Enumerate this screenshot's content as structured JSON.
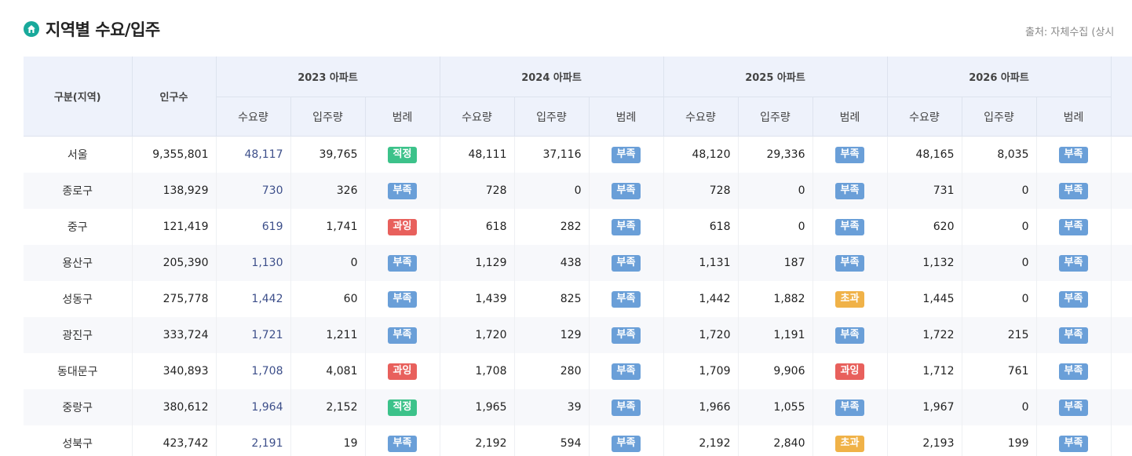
{
  "header": {
    "title": "지역별 수요/입주",
    "source": "출처: 자체수집 (상시"
  },
  "colors": {
    "적정": "#3cc28a",
    "부족": "#6a9fd8",
    "과잉": "#e8605c",
    "초과": "#f0b248"
  },
  "table": {
    "col_region": "구분(지역)",
    "col_population": "인구수",
    "years": [
      "2023 아파트",
      "2024 아파트",
      "2025 아파트",
      "2026 아파트"
    ],
    "sub": {
      "demand": "수요량",
      "supply": "입주량",
      "legend": "범례"
    },
    "rows": [
      {
        "region": "서울",
        "population": "9,355,801",
        "y": [
          [
            "48,117",
            "39,765",
            "적정"
          ],
          [
            "48,111",
            "37,116",
            "부족"
          ],
          [
            "48,120",
            "29,336",
            "부족"
          ],
          [
            "48,165",
            "8,035",
            "부족"
          ]
        ]
      },
      {
        "region": "종로구",
        "population": "138,929",
        "y": [
          [
            "730",
            "326",
            "부족"
          ],
          [
            "728",
            "0",
            "부족"
          ],
          [
            "728",
            "0",
            "부족"
          ],
          [
            "731",
            "0",
            "부족"
          ]
        ]
      },
      {
        "region": "중구",
        "population": "121,419",
        "y": [
          [
            "619",
            "1,741",
            "과잉"
          ],
          [
            "618",
            "282",
            "부족"
          ],
          [
            "618",
            "0",
            "부족"
          ],
          [
            "620",
            "0",
            "부족"
          ]
        ]
      },
      {
        "region": "용산구",
        "population": "205,390",
        "y": [
          [
            "1,130",
            "0",
            "부족"
          ],
          [
            "1,129",
            "438",
            "부족"
          ],
          [
            "1,131",
            "187",
            "부족"
          ],
          [
            "1,132",
            "0",
            "부족"
          ]
        ]
      },
      {
        "region": "성동구",
        "population": "275,778",
        "y": [
          [
            "1,442",
            "60",
            "부족"
          ],
          [
            "1,439",
            "825",
            "부족"
          ],
          [
            "1,442",
            "1,882",
            "초과"
          ],
          [
            "1,445",
            "0",
            "부족"
          ]
        ]
      },
      {
        "region": "광진구",
        "population": "333,724",
        "y": [
          [
            "1,721",
            "1,211",
            "부족"
          ],
          [
            "1,720",
            "129",
            "부족"
          ],
          [
            "1,720",
            "1,191",
            "부족"
          ],
          [
            "1,722",
            "215",
            "부족"
          ]
        ]
      },
      {
        "region": "동대문구",
        "population": "340,893",
        "y": [
          [
            "1,708",
            "4,081",
            "과잉"
          ],
          [
            "1,708",
            "280",
            "부족"
          ],
          [
            "1,709",
            "9,906",
            "과잉"
          ],
          [
            "1,712",
            "761",
            "부족"
          ]
        ]
      },
      {
        "region": "중랑구",
        "population": "380,612",
        "y": [
          [
            "1,964",
            "2,152",
            "적정"
          ],
          [
            "1,965",
            "39",
            "부족"
          ],
          [
            "1,966",
            "1,055",
            "부족"
          ],
          [
            "1,967",
            "0",
            "부족"
          ]
        ]
      },
      {
        "region": "성북구",
        "population": "423,742",
        "y": [
          [
            "2,191",
            "19",
            "부족"
          ],
          [
            "2,192",
            "594",
            "부족"
          ],
          [
            "2,192",
            "2,840",
            "초과"
          ],
          [
            "2,193",
            "199",
            "부족"
          ]
        ]
      }
    ]
  }
}
